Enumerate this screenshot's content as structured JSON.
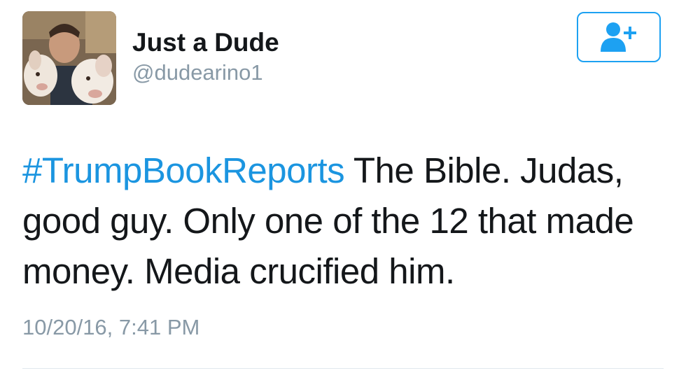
{
  "user": {
    "display_name": "Just a Dude",
    "handle": "@dudearino1"
  },
  "follow_button": {
    "icon": "add-user-icon"
  },
  "tweet": {
    "hashtag": "#TrumpBookReports",
    "text": " The Bible. Judas, good guy. Only one of the 12 that made money. Media crucified him.",
    "timestamp": "10/20/16, 7:41 PM"
  },
  "colors": {
    "accent": "#1da1f2",
    "hashtag": "#1b95e0",
    "text": "#14171a",
    "muted": "#8899a6",
    "divider": "#e1e8ed"
  }
}
